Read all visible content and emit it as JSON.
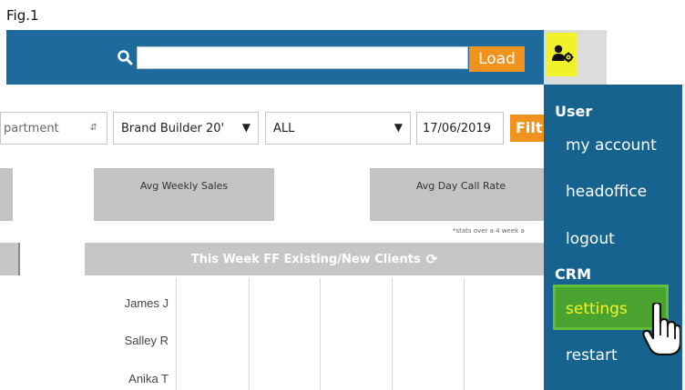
{
  "figure_label": "Fig.1",
  "topbar": {
    "search_placeholder": "",
    "load_label": "Load"
  },
  "filters": {
    "department": "partment",
    "brand": "Brand Builder 20'",
    "scope": "ALL",
    "date": "17/06/2019",
    "filter_label": "Filt"
  },
  "stats": {
    "weekly_sales_label": "Avg Weekly Sales",
    "day_call_rate_label": "Avg Day Call Rate",
    "note": "*stats over a 4 week a"
  },
  "table": {
    "header": "This Week FF Existing/New Clients",
    "rows": [
      "James J",
      "Salley R",
      "Anika T"
    ]
  },
  "menu": {
    "user_heading": "User",
    "my_account": "my account",
    "headoffice": "headoffice",
    "logout": "logout",
    "crm_heading": "CRM",
    "settings": "settings",
    "restart": "restart"
  },
  "colors": {
    "topbar": "#1e6a9c",
    "menu": "#17638f",
    "accent_orange": "#f0921e",
    "highlight_yellow": "#f2f22a",
    "highlight_green": "#4aa32f"
  },
  "icons": {
    "search": "search-icon",
    "user_settings": "user-cog-icon",
    "refresh": "refresh-icon",
    "pointer": "hand-pointer-icon"
  }
}
